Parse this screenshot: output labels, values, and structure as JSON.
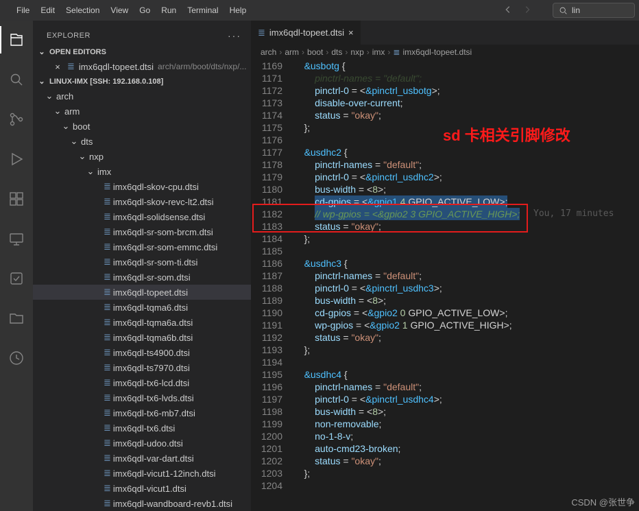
{
  "menu": {
    "file": "File",
    "edit": "Edit",
    "selection": "Selection",
    "view": "View",
    "go": "Go",
    "run": "Run",
    "terminal": "Terminal",
    "help": "Help"
  },
  "search_text": "lin",
  "sidebar": {
    "title": "EXPLORER",
    "open_editors": "OPEN EDITORS",
    "open_file": "imx6qdl-topeet.dtsi",
    "open_file_path": "arch/arm/boot/dts/nxp/...",
    "workspace": "LINUX-IMX [SSH: 192.168.0.108]",
    "folders": {
      "arch": "arch",
      "arm": "arm",
      "boot": "boot",
      "dts": "dts",
      "nxp": "nxp",
      "imx": "imx"
    },
    "files": [
      "imx6qdl-skov-cpu.dtsi",
      "imx6qdl-skov-revc-lt2.dtsi",
      "imx6qdl-solidsense.dtsi",
      "imx6qdl-sr-som-brcm.dtsi",
      "imx6qdl-sr-som-emmc.dtsi",
      "imx6qdl-sr-som-ti.dtsi",
      "imx6qdl-sr-som.dtsi",
      "imx6qdl-topeet.dtsi",
      "imx6qdl-tqma6.dtsi",
      "imx6qdl-tqma6a.dtsi",
      "imx6qdl-tqma6b.dtsi",
      "imx6qdl-ts4900.dtsi",
      "imx6qdl-ts7970.dtsi",
      "imx6qdl-tx6-lcd.dtsi",
      "imx6qdl-tx6-lvds.dtsi",
      "imx6qdl-tx6-mb7.dtsi",
      "imx6qdl-tx6.dtsi",
      "imx6qdl-udoo.dtsi",
      "imx6qdl-var-dart.dtsi",
      "imx6qdl-vicut1-12inch.dtsi",
      "imx6qdl-vicut1.dtsi",
      "imx6qdl-wandboard-revb1.dtsi"
    ],
    "selected_index": 7
  },
  "tab": {
    "name": "imx6qdl-topeet.dtsi"
  },
  "breadcrumb": [
    "arch",
    "arm",
    "boot",
    "dts",
    "nxp",
    "imx",
    "imx6qdl-topeet.dtsi"
  ],
  "annotation": "sd 卡相关引脚修改",
  "blame": "You, 17 minutes",
  "watermark": "CSDN @张世争",
  "code": [
    {
      "n": 1169,
      "i": 1,
      "seg": [
        [
          "func",
          "&usbotg"
        ],
        [
          "punc",
          " {"
        ]
      ]
    },
    {
      "n": 1171,
      "i": 2,
      "seg": [
        [
          "cmt",
          "pinctrl-names = \"default\";"
        ]
      ],
      "fade": true
    },
    {
      "n": 1172,
      "i": 2,
      "seg": [
        [
          "prop",
          "pinctrl-0"
        ],
        [
          "punc",
          " = <"
        ],
        [
          "const",
          "&pinctrl_usbotg"
        ],
        [
          "punc",
          ">;"
        ]
      ]
    },
    {
      "n": 1173,
      "i": 2,
      "seg": [
        [
          "prop",
          "disable-over-current"
        ],
        [
          "punc",
          ";"
        ]
      ]
    },
    {
      "n": 1174,
      "i": 2,
      "seg": [
        [
          "prop",
          "status"
        ],
        [
          "punc",
          " = "
        ],
        [
          "str",
          "\"okay\""
        ],
        [
          "punc",
          ";"
        ]
      ]
    },
    {
      "n": 1175,
      "i": 1,
      "seg": [
        [
          "punc",
          "};"
        ]
      ]
    },
    {
      "n": 1176,
      "i": 0,
      "seg": []
    },
    {
      "n": 1177,
      "i": 1,
      "seg": [
        [
          "func",
          "&usdhc2"
        ],
        [
          "punc",
          " {"
        ]
      ]
    },
    {
      "n": 1178,
      "i": 2,
      "seg": [
        [
          "prop",
          "pinctrl-names"
        ],
        [
          "punc",
          " = "
        ],
        [
          "str",
          "\"default\""
        ],
        [
          "punc",
          ";"
        ]
      ]
    },
    {
      "n": 1179,
      "i": 2,
      "seg": [
        [
          "prop",
          "pinctrl-0"
        ],
        [
          "punc",
          " = <"
        ],
        [
          "const",
          "&pinctrl_usdhc2"
        ],
        [
          "punc",
          ">;"
        ]
      ]
    },
    {
      "n": 1180,
      "i": 2,
      "seg": [
        [
          "prop",
          "bus-width"
        ],
        [
          "punc",
          " = <"
        ],
        [
          "num",
          "8"
        ],
        [
          "punc",
          ">;"
        ]
      ]
    },
    {
      "n": 1181,
      "i": 2,
      "sel": true,
      "seg": [
        [
          "prop",
          "cd-gpios"
        ],
        [
          "punc",
          " = <"
        ],
        [
          "const",
          "&gpio1"
        ],
        [
          "punc",
          " "
        ],
        [
          "num",
          "4"
        ],
        [
          "punc",
          " GPIO_ACTIVE_LOW>;"
        ]
      ]
    },
    {
      "n": 1182,
      "i": 2,
      "sel": true,
      "seg": [
        [
          "cmt",
          "// wp-gpios = <&gpio2 3 GPIO_ACTIVE_HIGH>;"
        ]
      ]
    },
    {
      "n": 1183,
      "i": 2,
      "seg": [
        [
          "prop",
          "status"
        ],
        [
          "punc",
          " = "
        ],
        [
          "str",
          "\"okay\""
        ],
        [
          "punc",
          ";"
        ]
      ]
    },
    {
      "n": 1184,
      "i": 1,
      "seg": [
        [
          "punc",
          "};"
        ]
      ]
    },
    {
      "n": 1185,
      "i": 0,
      "seg": []
    },
    {
      "n": 1186,
      "i": 1,
      "seg": [
        [
          "func",
          "&usdhc3"
        ],
        [
          "punc",
          " {"
        ]
      ]
    },
    {
      "n": 1187,
      "i": 2,
      "seg": [
        [
          "prop",
          "pinctrl-names"
        ],
        [
          "punc",
          " = "
        ],
        [
          "str",
          "\"default\""
        ],
        [
          "punc",
          ";"
        ]
      ]
    },
    {
      "n": 1188,
      "i": 2,
      "seg": [
        [
          "prop",
          "pinctrl-0"
        ],
        [
          "punc",
          " = <"
        ],
        [
          "const",
          "&pinctrl_usdhc3"
        ],
        [
          "punc",
          ">;"
        ]
      ]
    },
    {
      "n": 1189,
      "i": 2,
      "seg": [
        [
          "prop",
          "bus-width"
        ],
        [
          "punc",
          " = <"
        ],
        [
          "num",
          "8"
        ],
        [
          "punc",
          ">;"
        ]
      ]
    },
    {
      "n": 1190,
      "i": 2,
      "seg": [
        [
          "prop",
          "cd-gpios"
        ],
        [
          "punc",
          " = <"
        ],
        [
          "const",
          "&gpio2"
        ],
        [
          "punc",
          " "
        ],
        [
          "num",
          "0"
        ],
        [
          "punc",
          " GPIO_ACTIVE_LOW>;"
        ]
      ]
    },
    {
      "n": 1191,
      "i": 2,
      "seg": [
        [
          "prop",
          "wp-gpios"
        ],
        [
          "punc",
          " = <"
        ],
        [
          "const",
          "&gpio2"
        ],
        [
          "punc",
          " "
        ],
        [
          "num",
          "1"
        ],
        [
          "punc",
          " GPIO_ACTIVE_HIGH>;"
        ]
      ]
    },
    {
      "n": 1192,
      "i": 2,
      "seg": [
        [
          "prop",
          "status"
        ],
        [
          "punc",
          " = "
        ],
        [
          "str",
          "\"okay\""
        ],
        [
          "punc",
          ";"
        ]
      ]
    },
    {
      "n": 1193,
      "i": 1,
      "seg": [
        [
          "punc",
          "};"
        ]
      ]
    },
    {
      "n": 1194,
      "i": 0,
      "seg": []
    },
    {
      "n": 1195,
      "i": 1,
      "seg": [
        [
          "func",
          "&usdhc4"
        ],
        [
          "punc",
          " {"
        ]
      ]
    },
    {
      "n": 1196,
      "i": 2,
      "seg": [
        [
          "prop",
          "pinctrl-names"
        ],
        [
          "punc",
          " = "
        ],
        [
          "str",
          "\"default\""
        ],
        [
          "punc",
          ";"
        ]
      ]
    },
    {
      "n": 1197,
      "i": 2,
      "seg": [
        [
          "prop",
          "pinctrl-0"
        ],
        [
          "punc",
          " = <"
        ],
        [
          "const",
          "&pinctrl_usdhc4"
        ],
        [
          "punc",
          ">;"
        ]
      ]
    },
    {
      "n": 1198,
      "i": 2,
      "seg": [
        [
          "prop",
          "bus-width"
        ],
        [
          "punc",
          " = <"
        ],
        [
          "num",
          "8"
        ],
        [
          "punc",
          ">;"
        ]
      ]
    },
    {
      "n": 1199,
      "i": 2,
      "seg": [
        [
          "prop",
          "non-removable"
        ],
        [
          "punc",
          ";"
        ]
      ]
    },
    {
      "n": 1200,
      "i": 2,
      "seg": [
        [
          "prop",
          "no-1-8-v"
        ],
        [
          "punc",
          ";"
        ]
      ]
    },
    {
      "n": 1201,
      "i": 2,
      "seg": [
        [
          "prop",
          "auto-cmd23-broken"
        ],
        [
          "punc",
          ";"
        ]
      ]
    },
    {
      "n": 1202,
      "i": 2,
      "seg": [
        [
          "prop",
          "status"
        ],
        [
          "punc",
          " = "
        ],
        [
          "str",
          "\"okay\""
        ],
        [
          "punc",
          ";"
        ]
      ]
    },
    {
      "n": 1203,
      "i": 1,
      "seg": [
        [
          "punc",
          "};"
        ]
      ]
    },
    {
      "n": 1204,
      "i": 0,
      "seg": []
    }
  ]
}
